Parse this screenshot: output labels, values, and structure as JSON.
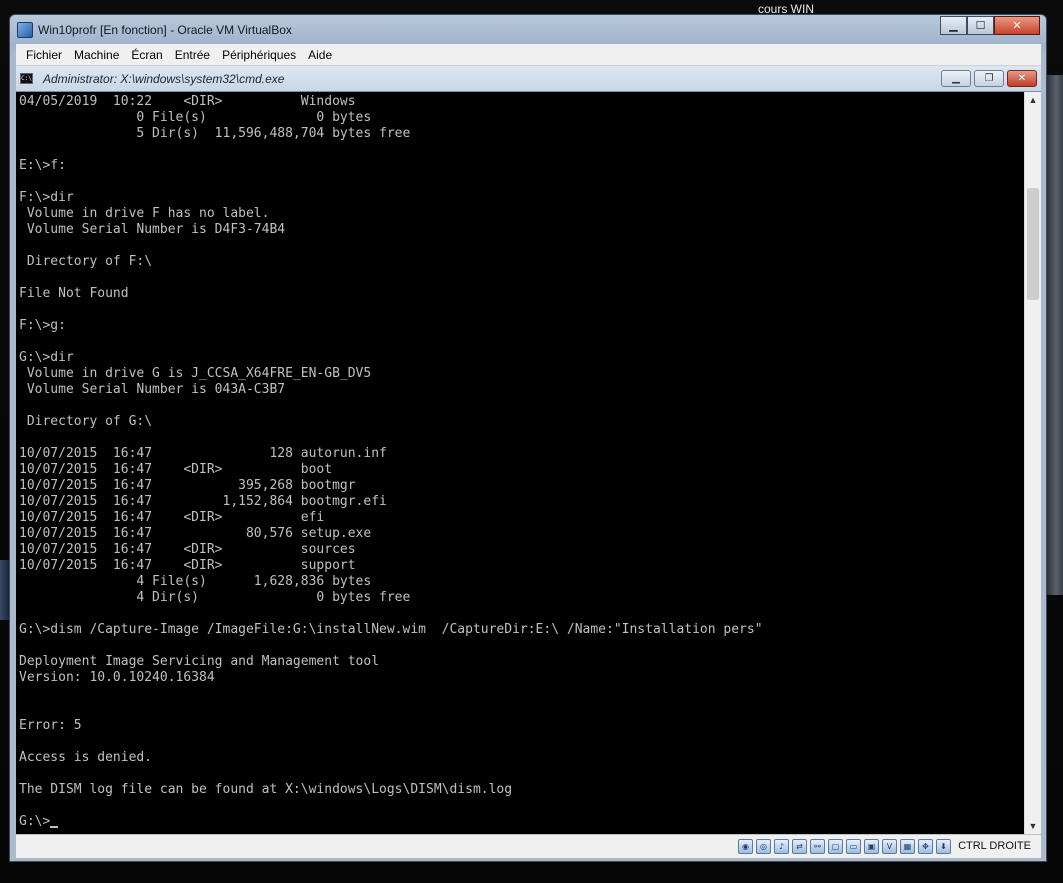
{
  "desktop": {
    "label": "cours  WIN"
  },
  "vbox": {
    "title": "Win10profr [En fonction] - Oracle VM VirtualBox",
    "menu": [
      "Fichier",
      "Machine",
      "Écran",
      "Entrée",
      "Périphériques",
      "Aide"
    ],
    "host_key": "CTRL DROITE",
    "status_icons": [
      "hard-disk-icon",
      "optical-drive-icon",
      "audio-icon",
      "network-icon",
      "usb-icon",
      "shared-folders-icon",
      "display-icon",
      "video-capture-icon",
      "vrde-icon",
      "cpu-icon",
      "mouse-integration-icon",
      "keyboard-icon"
    ]
  },
  "cmd": {
    "title": "Administrator: X:\\windows\\system32\\cmd.exe",
    "lines": [
      "04/05/2019  10:22    <DIR>          Windows",
      "               0 File(s)              0 bytes",
      "               5 Dir(s)  11,596,488,704 bytes free",
      "",
      "E:\\>f:",
      "",
      "F:\\>dir",
      " Volume in drive F has no label.",
      " Volume Serial Number is D4F3-74B4",
      "",
      " Directory of F:\\",
      "",
      "File Not Found",
      "",
      "F:\\>g:",
      "",
      "G:\\>dir",
      " Volume in drive G is J_CCSA_X64FRE_EN-GB_DV5",
      " Volume Serial Number is 043A-C3B7",
      "",
      " Directory of G:\\",
      "",
      "10/07/2015  16:47               128 autorun.inf",
      "10/07/2015  16:47    <DIR>          boot",
      "10/07/2015  16:47           395,268 bootmgr",
      "10/07/2015  16:47         1,152,864 bootmgr.efi",
      "10/07/2015  16:47    <DIR>          efi",
      "10/07/2015  16:47            80,576 setup.exe",
      "10/07/2015  16:47    <DIR>          sources",
      "10/07/2015  16:47    <DIR>          support",
      "               4 File(s)      1,628,836 bytes",
      "               4 Dir(s)               0 bytes free",
      "",
      "G:\\>dism /Capture-Image /ImageFile:G:\\installNew.wim  /CaptureDir:E:\\ /Name:\"Installation pers\"",
      "",
      "Deployment Image Servicing and Management tool",
      "Version: 10.0.10240.16384",
      "",
      "",
      "Error: 5",
      "",
      "Access is denied.",
      "",
      "The DISM log file can be found at X:\\windows\\Logs\\DISM\\dism.log",
      "",
      "G:\\>"
    ]
  }
}
